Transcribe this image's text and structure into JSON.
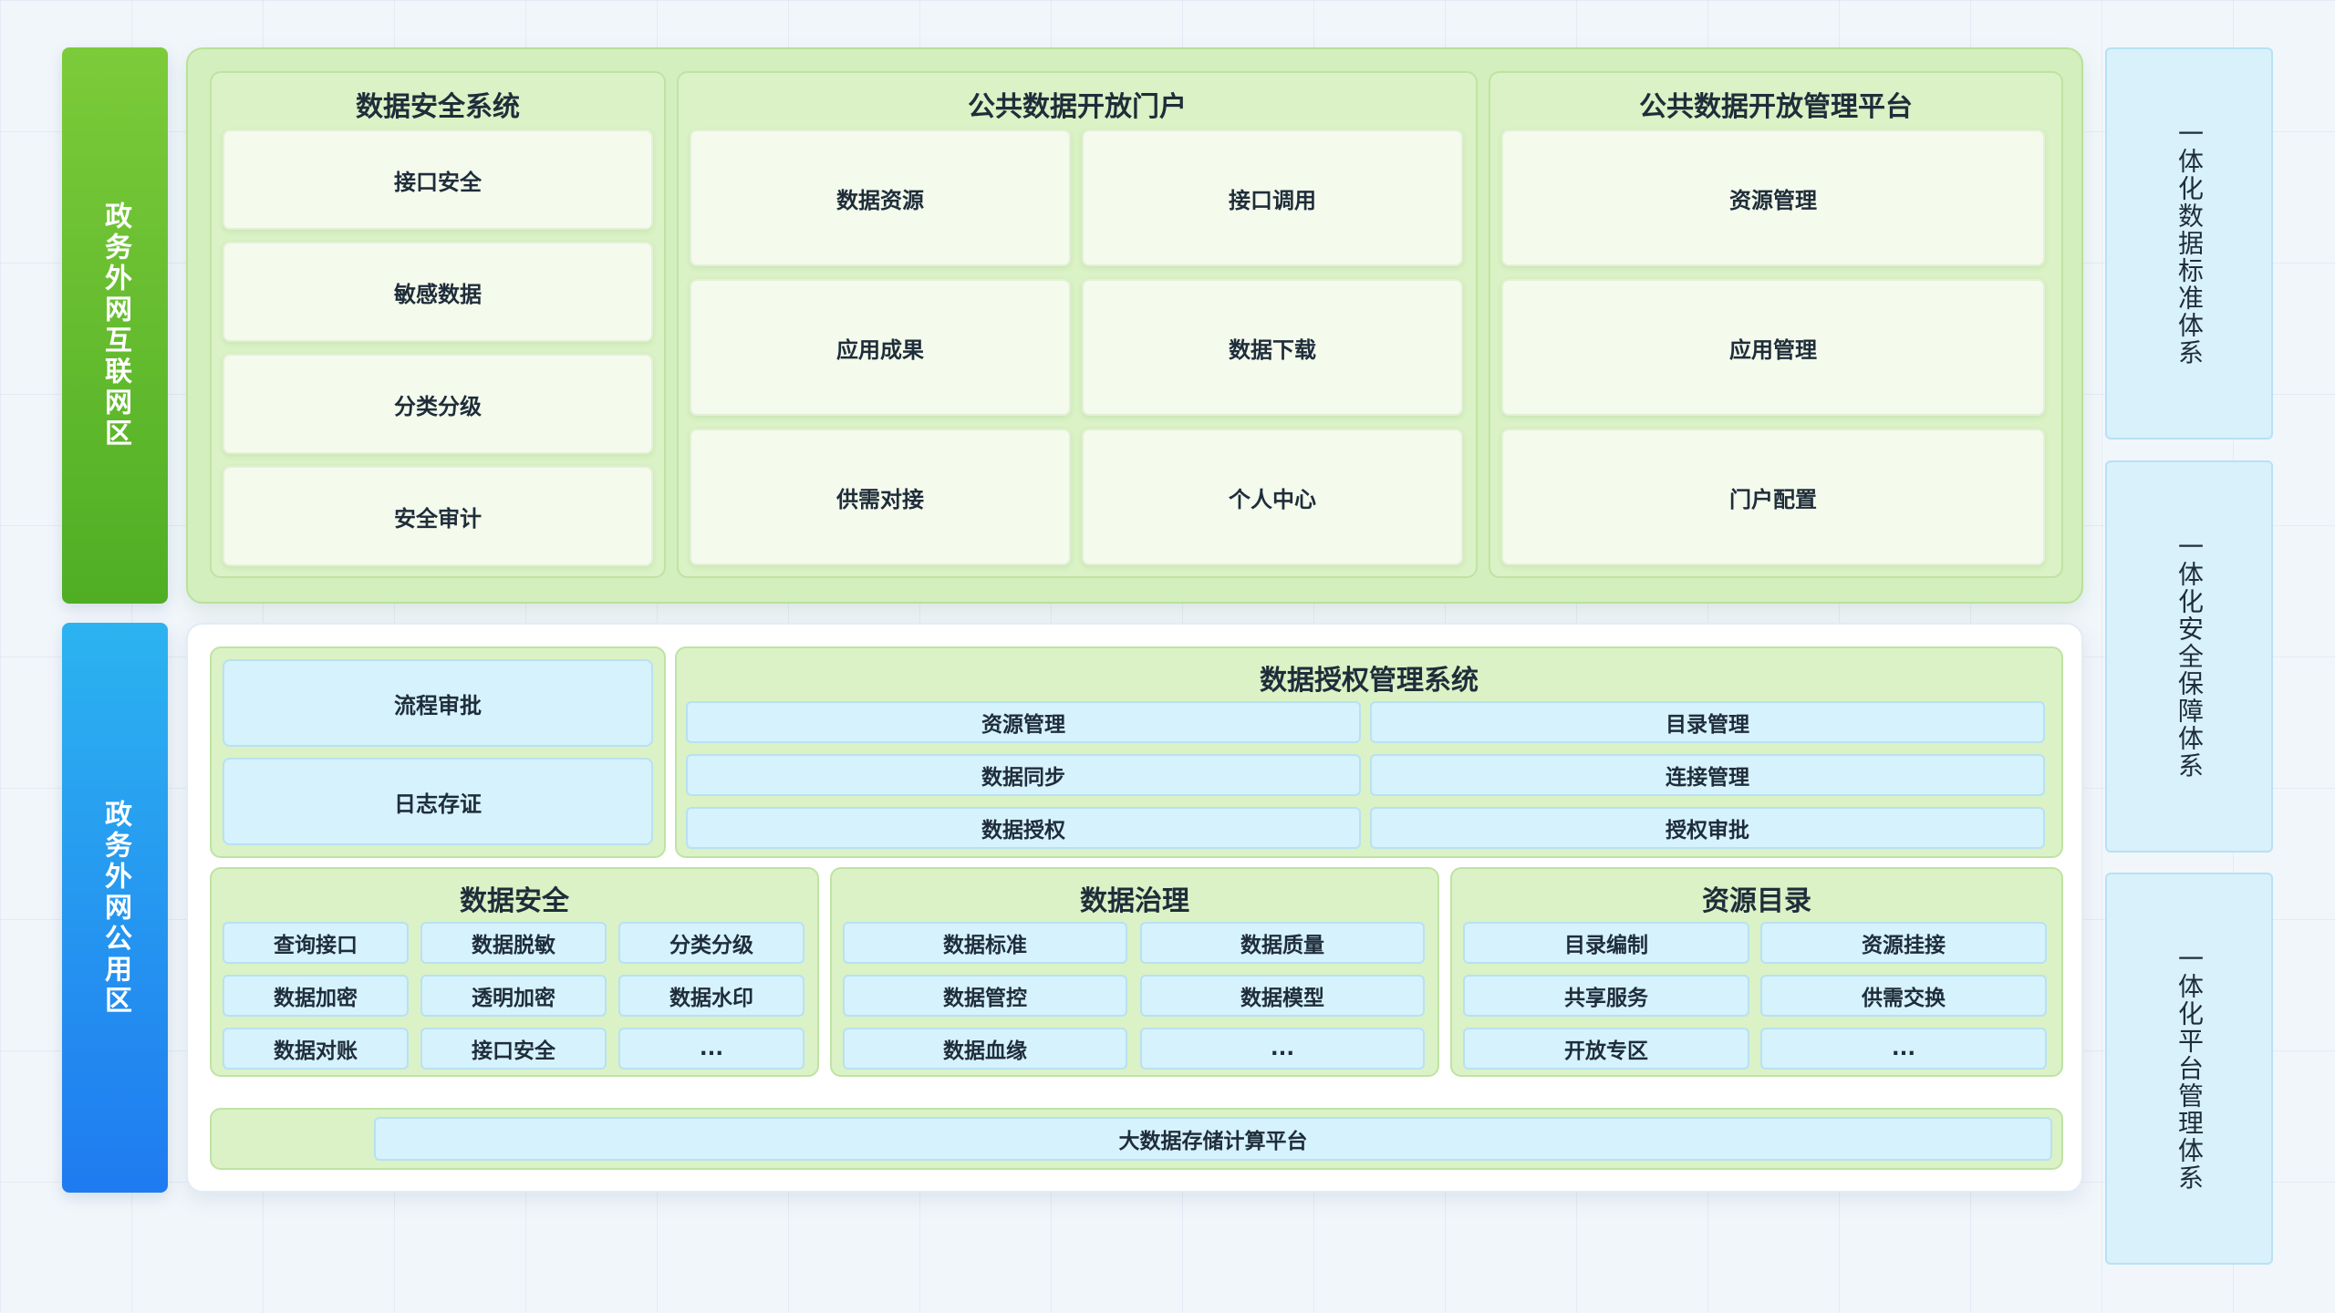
{
  "zones": {
    "internet": "政务外网互联网区",
    "public": "政务外网公用区"
  },
  "systems": [
    "一体化数据标准体系",
    "一体化安全保障体系",
    "一体化平台管理体系"
  ],
  "top": {
    "security_system": {
      "title": "数据安全系统",
      "items": [
        "接口安全",
        "敏感数据",
        "分类分级",
        "安全审计"
      ]
    },
    "portal": {
      "title": "公共数据开放门户",
      "items": [
        "数据资源",
        "接口调用",
        "应用成果",
        "数据下载",
        "供需对接",
        "个人中心"
      ]
    },
    "mgmt_platform": {
      "title": "公共数据开放管理平台",
      "items": [
        "资源管理",
        "应用管理",
        "门户配置"
      ]
    }
  },
  "bottom": {
    "workflow": {
      "items": [
        "流程审批",
        "日志存证"
      ]
    },
    "auth_system": {
      "title": "数据授权管理系统",
      "items": [
        "资源管理",
        "目录管理",
        "数据同步",
        "连接管理",
        "数据授权",
        "授权审批"
      ]
    },
    "data_security": {
      "title": "数据安全",
      "items": [
        "查询接口",
        "数据脱敏",
        "分类分级",
        "数据加密",
        "透明加密",
        "数据水印",
        "数据对账",
        "接口安全",
        "..."
      ]
    },
    "governance": {
      "title": "数据治理",
      "items": [
        "数据标准",
        "数据质量",
        "数据管控",
        "数据模型",
        "数据血缘",
        "..."
      ]
    },
    "catalog": {
      "title": "资源目录",
      "items": [
        "目录编制",
        "资源挂接",
        "共享服务",
        "供需交换",
        "开放专区",
        "..."
      ]
    },
    "platform": "大数据存储计算平台"
  }
}
